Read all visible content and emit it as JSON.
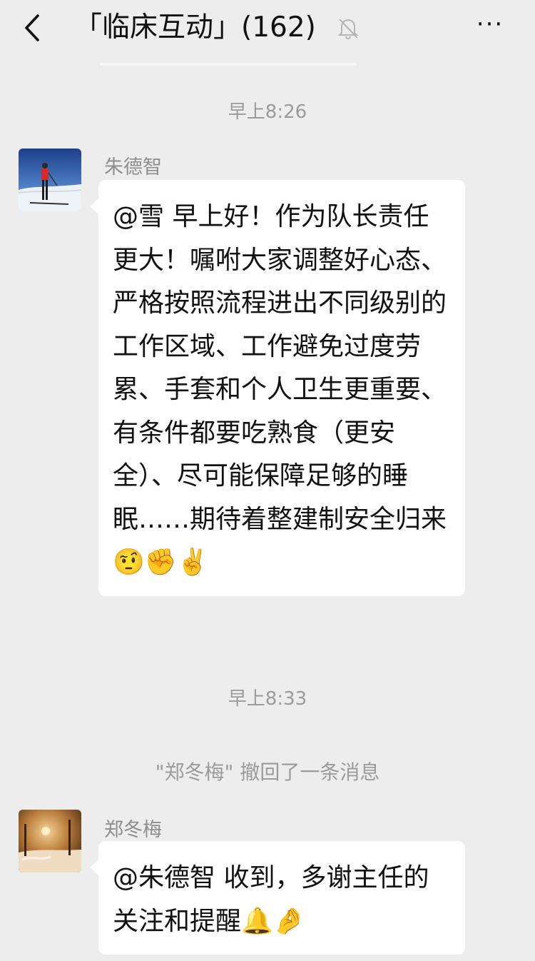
{
  "header": {
    "title": "「临床互动」(162)",
    "back_icon": "chevron-left-icon",
    "mute_icon": "bell-off-icon",
    "more_label": "···"
  },
  "messages": [
    {
      "type": "time",
      "text": "早上8:26"
    },
    {
      "type": "chat",
      "sender": "朱德智",
      "avatar": "skier-avatar",
      "text": "@雪  早上好！作为队长责任更大！嘱咐大家调整好心态、严格按照流程进出不同级别的工作区域、工作避免过度劳累、手套和个人卫生更重要、有条件都要吃熟食（更安全）、尽可能保障足够的睡眠……期待着整建制安全归来",
      "emojis": [
        "🤨",
        "✊",
        "✌️"
      ]
    },
    {
      "type": "time",
      "text": "早上8:33"
    },
    {
      "type": "system",
      "text": "\"郑冬梅\" 撤回了一条消息"
    },
    {
      "type": "chat",
      "sender": "郑冬梅",
      "avatar": "snowy-street-avatar",
      "text": "@朱德智  收到，多谢主任的关注和提醒",
      "emojis": [
        "🔔",
        "🤌"
      ]
    }
  ],
  "colors": {
    "background": "#ededed",
    "bubble": "#ffffff",
    "meta_text": "#9b9b9b"
  }
}
